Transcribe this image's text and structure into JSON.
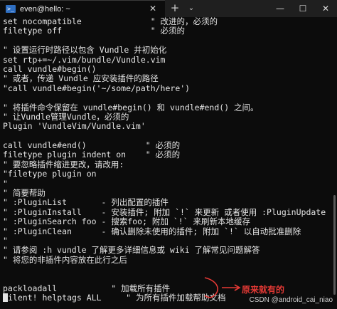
{
  "window": {
    "tab_icon": "terminal-icon",
    "tab_title": "even@hello: ~",
    "tab_close": "✕",
    "new_tab": "+",
    "dropdown": "⌄",
    "minimize": "—",
    "maximize": "☐",
    "close": "✕"
  },
  "terminal": {
    "lines": [
      "set nocompatible              \" 改进的，必须的",
      "filetype off                  \" 必须的",
      "",
      "\" 设置运行时路径以包含 Vundle 并初始化",
      "set rtp+=~/.vim/bundle/Vundle.vim",
      "call vundle#begin()",
      "\" 或者，传递 Vundle 应安装插件的路径",
      "\"call vundle#begin('~/some/path/here')",
      "",
      "\" 将插件命令保留在 vundle#begin() 和 vundle#end() 之间。",
      "\" 让Vundle管理Vundle，必须的",
      "Plugin 'VundleVim/Vundle.vim'",
      "",
      "call vundle#end()            \" 必须的",
      "filetype plugin indent on    \" 必须的",
      "\" 要忽略插件缩进更改，请改用:",
      "\"filetype plugin on",
      "\"",
      "\" 简要帮助",
      "\" :PluginList       - 列出配置的插件",
      "\" :PluginInstall    - 安装插件; 附加 `!` 来更新 或者使用 :PluginUpdate",
      "\" :PluginSearch foo - 搜索foo; 附加 `!` 来刷新本地缓存",
      "\" :PluginClean      - 确认删除未使用的插件; 附加 `!` 以自动批准删除",
      "\"",
      "\" 请参阅 :h vundle 了解更多详细信息或 wiki 了解常见问题解答",
      "\" 将您的非插件内容放在此行之后",
      "",
      "",
      "packloadall           \" 加载所有插件",
      "ilent! helptags ALL     \" 为所有插件加载帮助文档",
      "",
      ""
    ]
  },
  "annotation": {
    "text": "原来就有的",
    "color": "#e53935"
  },
  "watermark": "CSDN @android_cai_niao"
}
